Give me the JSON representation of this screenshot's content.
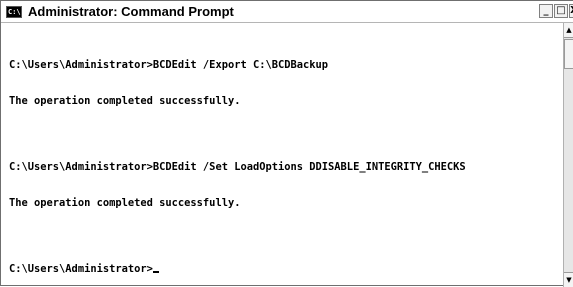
{
  "window": {
    "title": "Administrator: Command Prompt",
    "icon": "command-prompt-icon",
    "icon_text": "C:\\",
    "buttons": {
      "minimize": "_",
      "maximize": "□",
      "close": "X"
    }
  },
  "console": {
    "lines": [
      "C:\\Users\\Administrator>BCDEdit /Export C:\\BCDBackup",
      "The operation completed successfully.",
      "C:\\Users\\Administrator>BCDEdit /Set LoadOptions DDISABLE_INTEGRITY_CHECKS",
      "The operation completed successfully.",
      "C:\\Users\\Administrator>"
    ]
  },
  "scrollbar": {
    "up_arrow": "▲",
    "down_arrow": "▼"
  }
}
